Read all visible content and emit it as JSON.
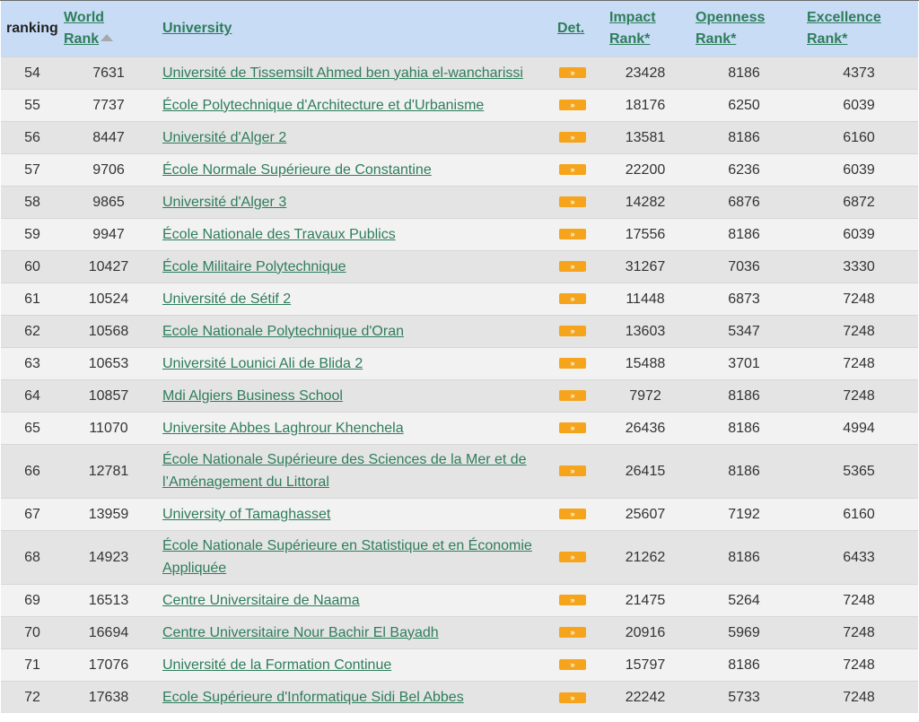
{
  "header": {
    "ranking": "ranking",
    "world_rank_line1": "World",
    "world_rank_line2": "Rank",
    "university": "University",
    "det": "Det.",
    "impact_line1": "Impact",
    "impact_line2": "Rank*",
    "openness_line1": "Openness",
    "openness_line2": "Rank*",
    "excellence_line1": "Excellence",
    "excellence_line2": "Rank*"
  },
  "det_icon": "double-chevron-right-icon",
  "colors": {
    "header_bg": "#c8dcf6",
    "link": "#2e7d5b",
    "det_button": "#f5a41c"
  },
  "rows": [
    {
      "ranking": "54",
      "world": "7631",
      "university": "Université de Tissemsilt Ahmed ben yahia el-wancharissi",
      "impact": "23428",
      "openness": "8186",
      "excellence": "4373"
    },
    {
      "ranking": "55",
      "world": "7737",
      "university": "École Polytechnique d'Architecture et d'Urbanisme",
      "impact": "18176",
      "openness": "6250",
      "excellence": "6039"
    },
    {
      "ranking": "56",
      "world": "8447",
      "university": "Université d'Alger 2",
      "impact": "13581",
      "openness": "8186",
      "excellence": "6160"
    },
    {
      "ranking": "57",
      "world": "9706",
      "university": "École Normale Supérieure de Constantine",
      "impact": "22200",
      "openness": "6236",
      "excellence": "6039"
    },
    {
      "ranking": "58",
      "world": "9865",
      "university": "Université d'Alger 3",
      "impact": "14282",
      "openness": "6876",
      "excellence": "6872"
    },
    {
      "ranking": "59",
      "world": "9947",
      "university": "École Nationale des Travaux Publics",
      "impact": "17556",
      "openness": "8186",
      "excellence": "6039"
    },
    {
      "ranking": "60",
      "world": "10427",
      "university": "École Militaire Polytechnique",
      "impact": "31267",
      "openness": "7036",
      "excellence": "3330"
    },
    {
      "ranking": "61",
      "world": "10524",
      "university": "Université de Sétif 2",
      "impact": "11448",
      "openness": "6873",
      "excellence": "7248"
    },
    {
      "ranking": "62",
      "world": "10568",
      "university": "Ecole Nationale Polytechnique d'Oran",
      "impact": "13603",
      "openness": "5347",
      "excellence": "7248"
    },
    {
      "ranking": "63",
      "world": "10653",
      "university": "Université Lounici Ali de Blida 2",
      "impact": "15488",
      "openness": "3701",
      "excellence": "7248"
    },
    {
      "ranking": "64",
      "world": "10857",
      "university": "Mdi Algiers Business School",
      "impact": "7972",
      "openness": "8186",
      "excellence": "7248"
    },
    {
      "ranking": "65",
      "world": "11070",
      "university": "Universite Abbes Laghrour Khenchela",
      "impact": "26436",
      "openness": "8186",
      "excellence": "4994"
    },
    {
      "ranking": "66",
      "world": "12781",
      "university": "École Nationale Supérieure des Sciences de la Mer et de l’Aménagement du Littoral",
      "impact": "26415",
      "openness": "8186",
      "excellence": "5365"
    },
    {
      "ranking": "67",
      "world": "13959",
      "university": "University of Tamaghasset",
      "impact": "25607",
      "openness": "7192",
      "excellence": "6160"
    },
    {
      "ranking": "68",
      "world": "14923",
      "university": "École Nationale Supérieure en Statistique et en Économie Appliquée",
      "impact": "21262",
      "openness": "8186",
      "excellence": "6433"
    },
    {
      "ranking": "69",
      "world": "16513",
      "university": "Centre Universitaire de Naama",
      "impact": "21475",
      "openness": "5264",
      "excellence": "7248"
    },
    {
      "ranking": "70",
      "world": "16694",
      "university": "Centre Universitaire Nour Bachir El Bayadh",
      "impact": "20916",
      "openness": "5969",
      "excellence": "7248"
    },
    {
      "ranking": "71",
      "world": "17076",
      "university": "Université de la Formation Continue",
      "impact": "15797",
      "openness": "8186",
      "excellence": "7248"
    },
    {
      "ranking": "72",
      "world": "17638",
      "university": "Ecole Supérieure d'Informatique Sidi Bel Abbes",
      "impact": "22242",
      "openness": "5733",
      "excellence": "7248"
    }
  ]
}
